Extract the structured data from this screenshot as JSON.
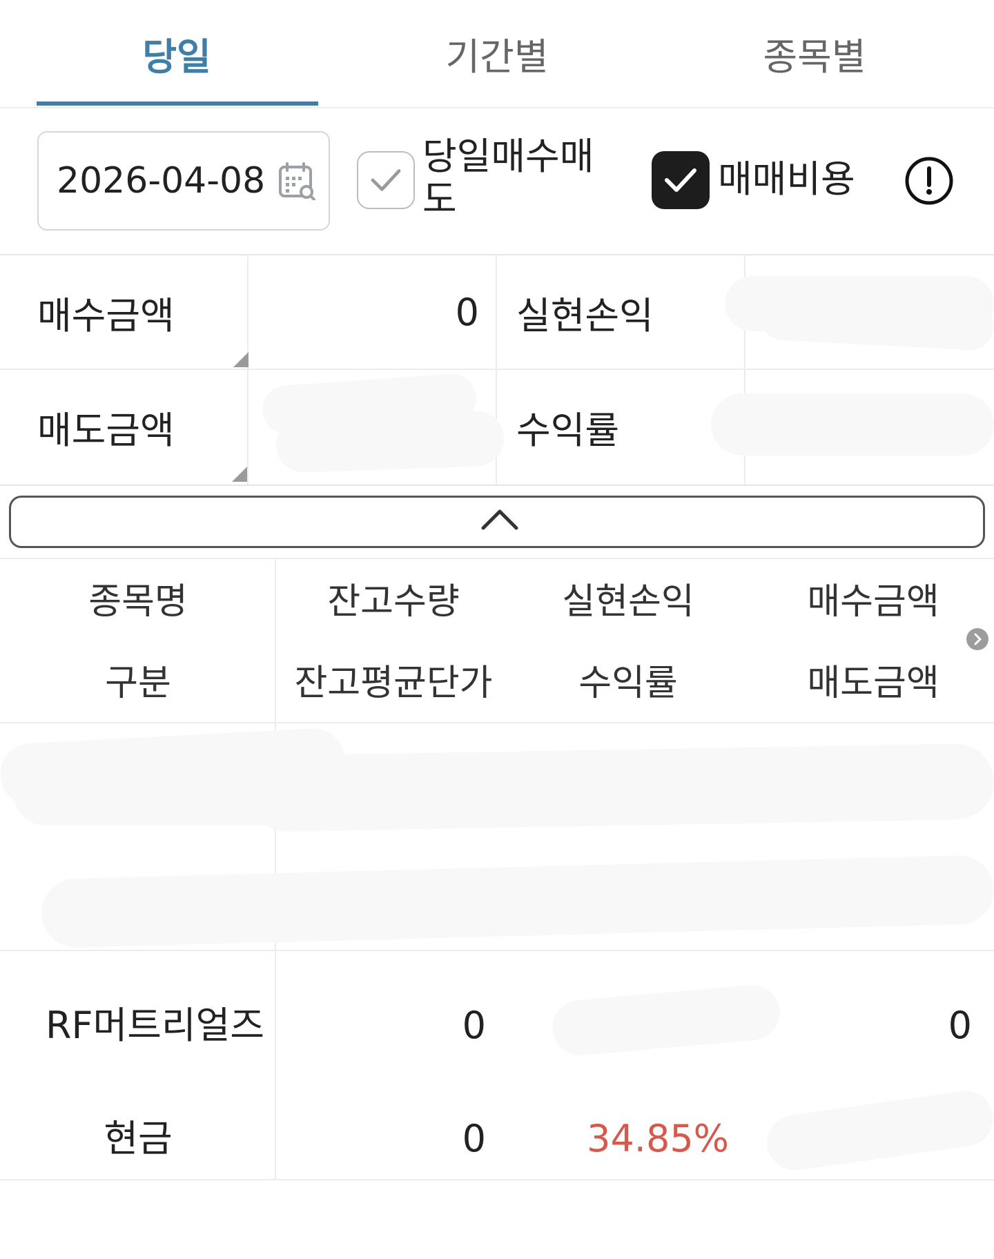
{
  "tabs": [
    {
      "label": "당일",
      "active": true
    },
    {
      "label": "기간별",
      "active": false
    },
    {
      "label": "종목별",
      "active": false
    }
  ],
  "filters": {
    "date": "2026-04-08",
    "same_day_trade_label": "당일매수매도",
    "same_day_trade_checked": false,
    "trade_cost_label": "매매비용",
    "trade_cost_checked": true
  },
  "summary": {
    "buy_amount_label": "매수금액",
    "buy_amount_value": "0",
    "realized_pnl_label": "실현손익",
    "sell_amount_label": "매도금액",
    "return_rate_label": "수익률"
  },
  "table": {
    "headers_row1": [
      "종목명",
      "잔고수량",
      "실현손익",
      "매수금액"
    ],
    "headers_row2": [
      "구분",
      "잔고평균단가",
      "수익률",
      "매도금액"
    ],
    "rows": [
      {
        "name": "RF머트리얼즈",
        "type": "현금",
        "balance_qty": "0",
        "avg_price": "0",
        "return_rate": "34.85%",
        "buy_amount": "0"
      }
    ]
  },
  "colors": {
    "accent": "#3f7ea6",
    "loss_profit_red": "#d65a4c"
  }
}
